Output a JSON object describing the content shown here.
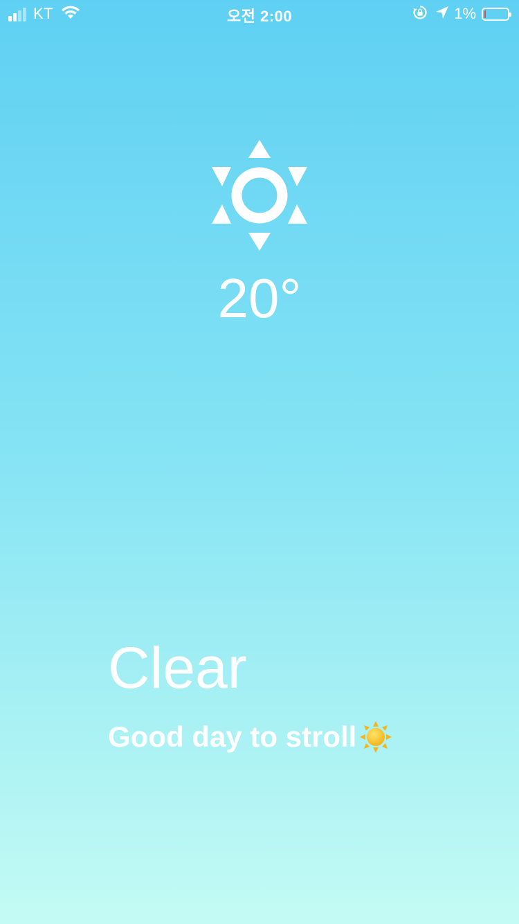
{
  "status_bar": {
    "carrier": "KT",
    "time": "오전 2:00",
    "battery_percent_label": "1%",
    "battery_level": 0.01,
    "signal_bars_filled": 2,
    "signal_bars_total": 4,
    "icons": [
      "signal-icon",
      "wifi-icon",
      "orientation-lock-icon",
      "location-arrow-icon",
      "battery-icon"
    ]
  },
  "weather": {
    "icon": "sun-icon",
    "temperature": "20°",
    "condition": "Clear",
    "message": "Good day to stroll",
    "message_emoji_icon": "sun-emoji-icon"
  },
  "colors": {
    "gradient_top": "#5fd0f3",
    "gradient_bottom": "#c4fbf4",
    "text": "#ffffff",
    "battery_low": "#e24b3b"
  }
}
